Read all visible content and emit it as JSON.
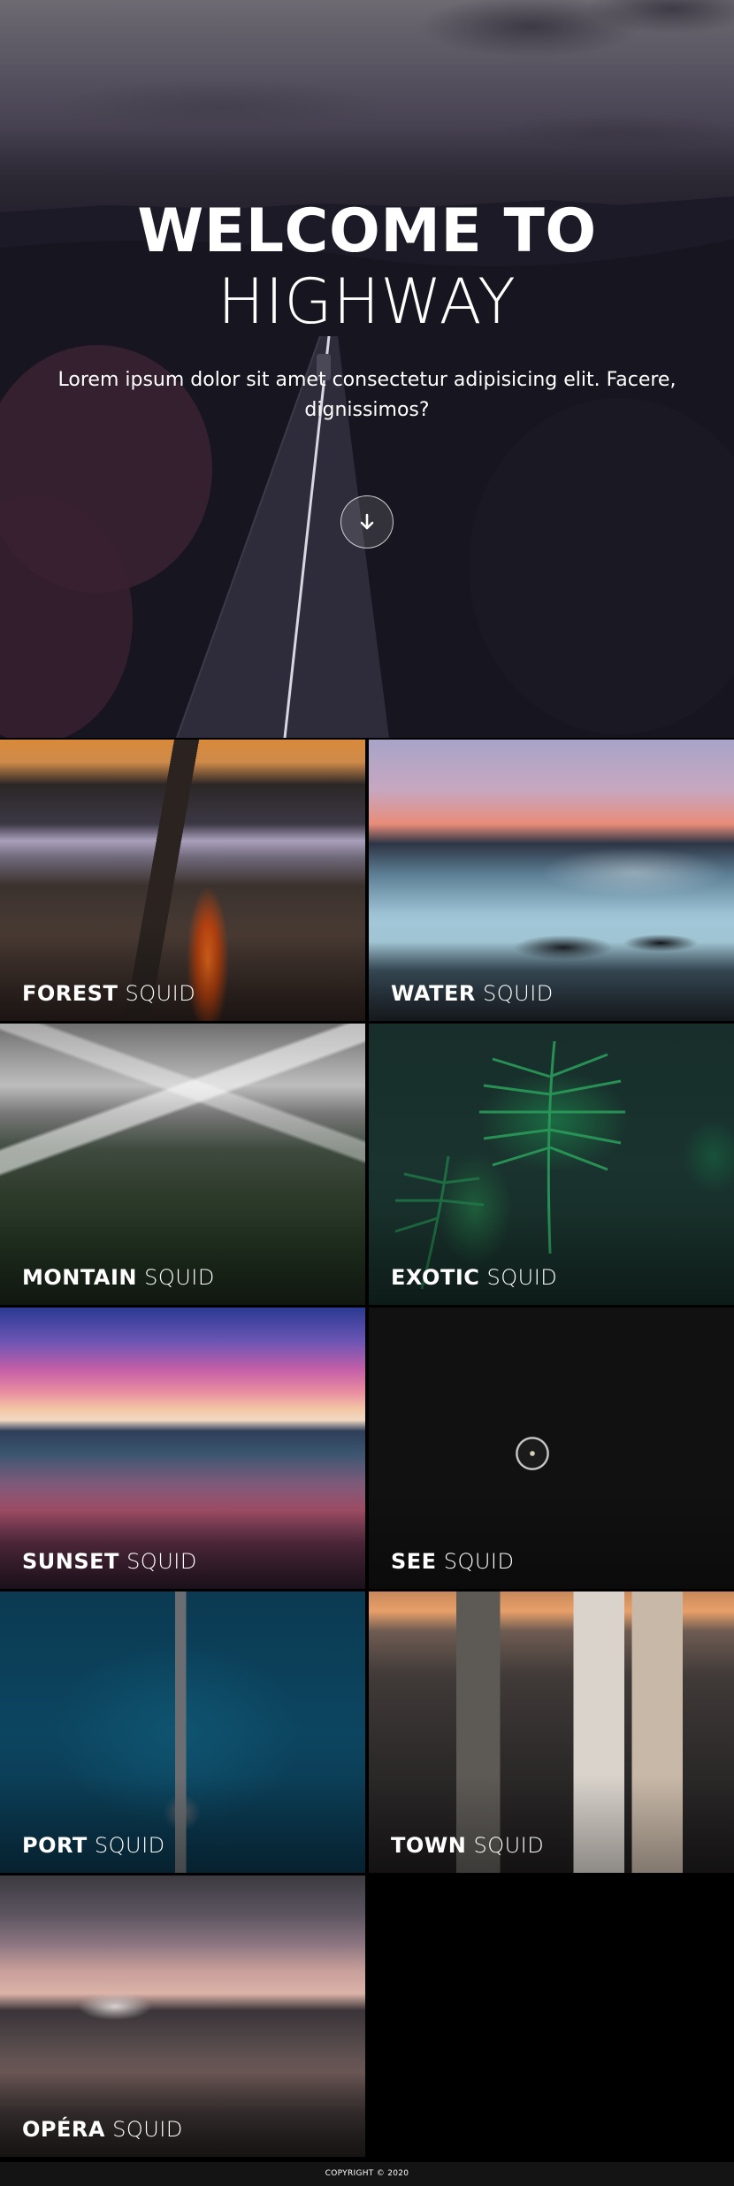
{
  "hero": {
    "title_line1": "WELCOME TO",
    "title_line2": "HIGHWAY",
    "text": "Lorem ipsum dolor sit amet consectetur adipisicing elit. Facere, dignissimos?",
    "scroll_icon": "arrow-down-icon"
  },
  "gallery": {
    "items": [
      {
        "bold": "FOREST",
        "light": "SQUID"
      },
      {
        "bold": "WATER",
        "light": "SQUID"
      },
      {
        "bold": "MONTAIN",
        "light": "SQUID"
      },
      {
        "bold": "EXOTIC",
        "light": "SQUID"
      },
      {
        "bold": "SUNSET",
        "light": "SQUID"
      },
      {
        "bold": "SEE",
        "light": "SQUID"
      },
      {
        "bold": "PORT",
        "light": "SQUID"
      },
      {
        "bold": "TOWN",
        "light": "SQUID"
      },
      {
        "bold": "OPÉRA",
        "light": "SQUID"
      }
    ]
  },
  "footer": {
    "copyright": "COPYRIGHT © 2020"
  }
}
